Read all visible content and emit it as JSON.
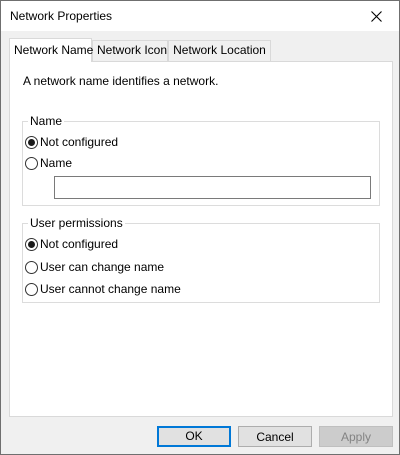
{
  "window": {
    "title": "Network Properties"
  },
  "tabs": [
    {
      "label": "Network Name",
      "active": true
    },
    {
      "label": "Network Icon",
      "active": false
    },
    {
      "label": "Network Location",
      "active": false
    }
  ],
  "panel": {
    "description": "A network name identifies a network.",
    "name_group": {
      "legend": "Name",
      "options": [
        {
          "label": "Not configured",
          "checked": true
        },
        {
          "label": "Name",
          "checked": false
        }
      ],
      "name_input_value": ""
    },
    "permissions_group": {
      "legend": "User permissions",
      "options": [
        {
          "label": "Not configured",
          "checked": true
        },
        {
          "label": "User can change name",
          "checked": false
        },
        {
          "label": "User cannot change name",
          "checked": false
        }
      ]
    }
  },
  "buttons": {
    "ok": "OK",
    "cancel": "Cancel",
    "apply": "Apply"
  },
  "icons": {
    "close": "close-icon"
  },
  "colors": {
    "default_button_border": "#0078d7",
    "disabled_text": "#838383"
  }
}
